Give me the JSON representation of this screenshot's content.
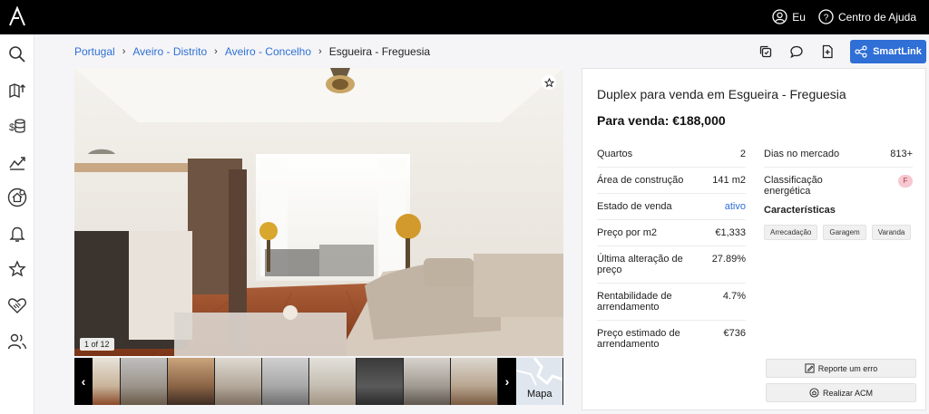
{
  "topbar": {
    "user_label": "Eu",
    "help_label": "Centro de Ajuda"
  },
  "sidebar": {
    "items": [
      {
        "icon": "search-icon"
      },
      {
        "icon": "map-upload-icon"
      },
      {
        "icon": "money-stack-icon"
      },
      {
        "icon": "market-chart-icon"
      },
      {
        "icon": "home-settings-icon"
      },
      {
        "icon": "bell-icon"
      },
      {
        "icon": "star-icon"
      },
      {
        "icon": "handshake-icon"
      },
      {
        "icon": "users-icon"
      }
    ]
  },
  "breadcrumb": {
    "items": [
      "Portugal",
      "Aveiro - Distrito",
      "Aveiro - Concelho"
    ],
    "current": "Esgueira - Freguesia"
  },
  "toolbar": {
    "smartlink_label": "SmartLink"
  },
  "gallery": {
    "counter": "1 of 12",
    "map_label": "Mapa"
  },
  "listing": {
    "title": "Duplex para venda em Esgueira - Freguesia",
    "price": "Para venda: €188,000",
    "left": [
      {
        "label": "Quartos",
        "value": "2"
      },
      {
        "label": "Área de construção",
        "value": "141 m2"
      },
      {
        "label": "Estado de venda",
        "value": "ativo"
      },
      {
        "label": "Preço por m2",
        "value": "€1,333"
      },
      {
        "label": "Última alteração de preço",
        "value": "27.89%"
      },
      {
        "label": "Rentabilidade de arrendamento",
        "value": "4.7%"
      },
      {
        "label": "Preço estimado de arrendamento",
        "value": "€736"
      }
    ],
    "right": [
      {
        "label": "Dias no mercado",
        "value": "813+"
      },
      {
        "label": "Classificação energética",
        "value": "F"
      }
    ],
    "features_title": "Características",
    "features": [
      "Arrecadação",
      "Garagem",
      "Varanda"
    ],
    "report_label": "Reporte um erro",
    "acm_label": "Realizar ACM"
  },
  "colors": {
    "accent": "#2f6fd6",
    "topbar": "#000000",
    "energy_badge": "#f6c8cf"
  }
}
